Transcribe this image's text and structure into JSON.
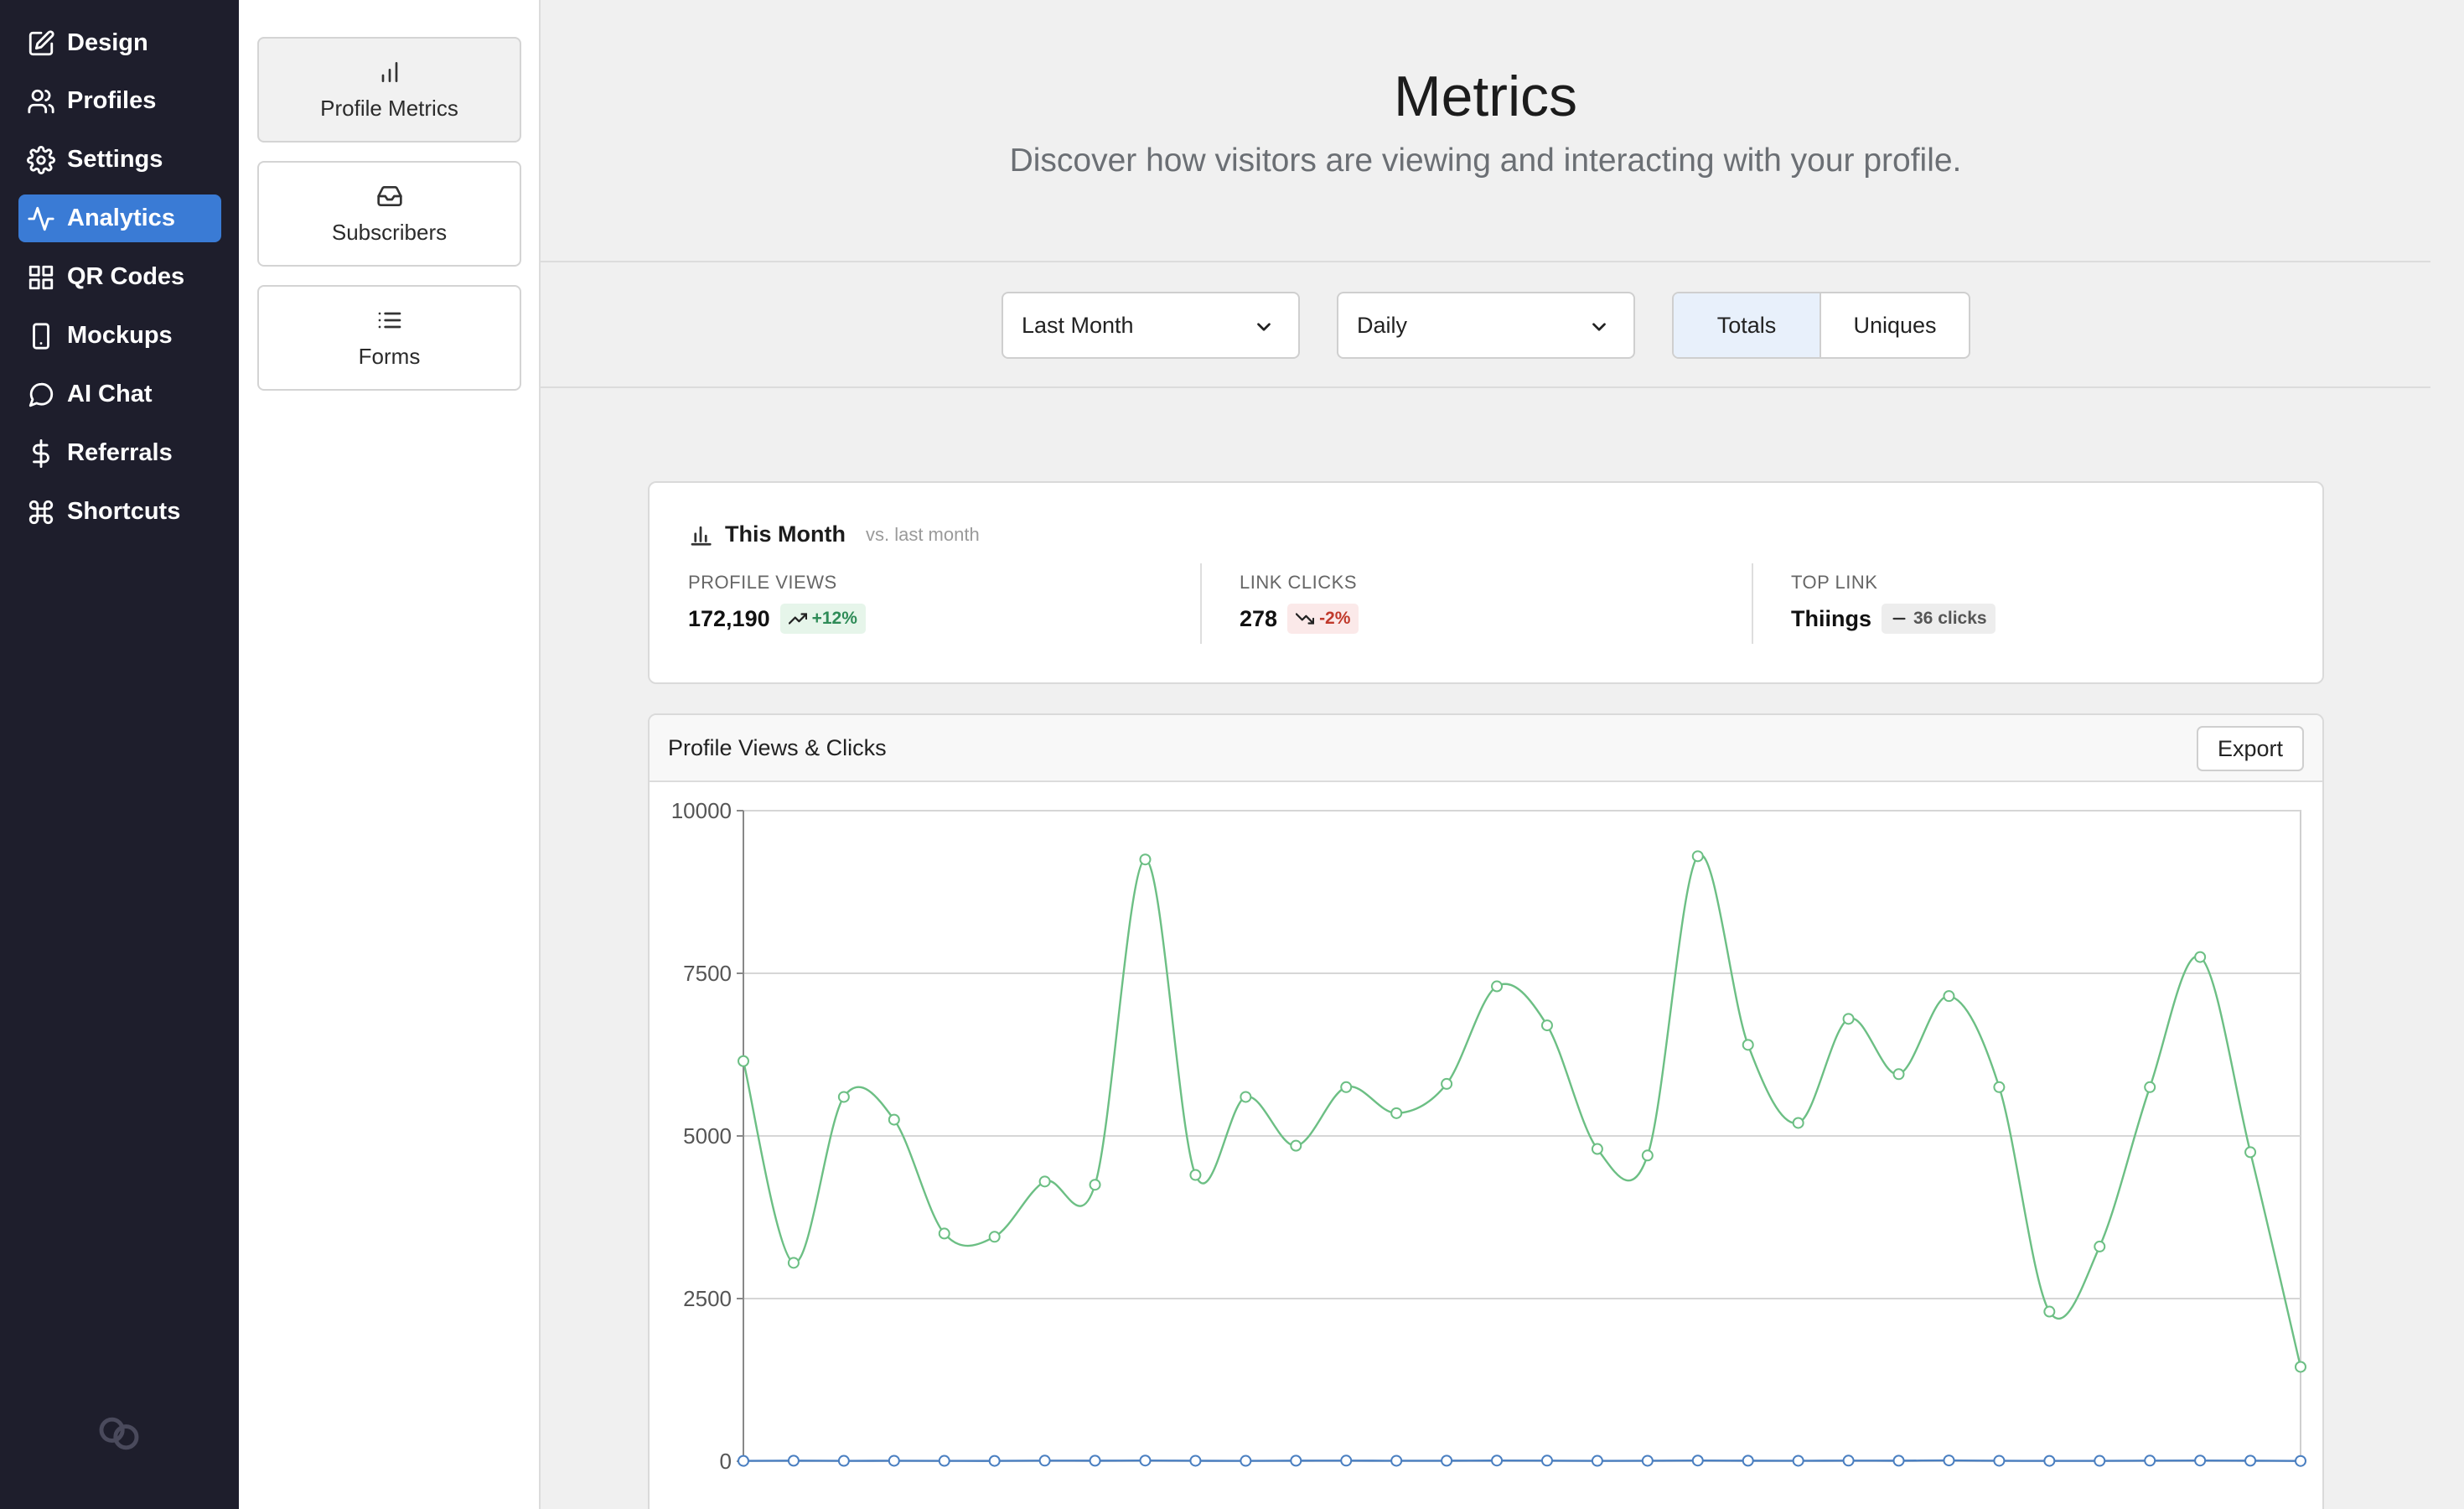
{
  "nav": {
    "items": [
      {
        "label": "Design",
        "icon": "edit-icon"
      },
      {
        "label": "Profiles",
        "icon": "users-icon"
      },
      {
        "label": "Settings",
        "icon": "gear-icon"
      },
      {
        "label": "Analytics",
        "icon": "activity-icon",
        "active": true
      },
      {
        "label": "QR Codes",
        "icon": "grid-icon"
      },
      {
        "label": "Mockups",
        "icon": "phone-icon"
      },
      {
        "label": "AI Chat",
        "icon": "chat-icon"
      },
      {
        "label": "Referrals",
        "icon": "dollar-icon"
      },
      {
        "label": "Shortcuts",
        "icon": "command-icon"
      }
    ],
    "active_color": "#3a7bd5",
    "background": "#1e1e2c"
  },
  "subnav": {
    "items": [
      {
        "label": "Profile Metrics",
        "icon": "bar-chart-icon",
        "active": true
      },
      {
        "label": "Subscribers",
        "icon": "inbox-icon"
      },
      {
        "label": "Forms",
        "icon": "list-icon"
      }
    ]
  },
  "header": {
    "title": "Metrics",
    "subtitle": "Discover how visitors are viewing and interacting with your profile."
  },
  "filters": {
    "range": "Last Month",
    "interval": "Daily",
    "mode_options": [
      "Totals",
      "Uniques"
    ],
    "mode_selected": "Totals"
  },
  "summary": {
    "title": "This Month",
    "comparison": "vs. last month",
    "stats": [
      {
        "label": "PROFILE VIEWS",
        "value": "172,190",
        "change": "+12%",
        "trend": "up"
      },
      {
        "label": "LINK CLICKS",
        "value": "278",
        "change": "-2%",
        "trend": "down"
      },
      {
        "label": "TOP LINK",
        "value": "Thiings",
        "change": "36 clicks",
        "trend": "neutral"
      }
    ],
    "colors": {
      "up": "#2e8b57",
      "down": "#c0392b"
    }
  },
  "chart": {
    "title": "Profile Views & Clicks",
    "export_label": "Export"
  },
  "chart_data": {
    "type": "line",
    "ylim": [
      0,
      10000
    ],
    "yticks": [
      0,
      2500,
      5000,
      7500,
      10000
    ],
    "x": [
      1,
      2,
      3,
      4,
      5,
      6,
      7,
      8,
      9,
      10,
      11,
      12,
      13,
      14,
      15,
      16,
      17,
      18,
      19,
      20,
      21,
      22,
      23,
      24,
      25,
      26,
      27,
      28,
      29,
      30,
      31,
      32
    ],
    "series": [
      {
        "color": "#6cbf84",
        "values": [
          6150,
          3050,
          5600,
          5250,
          3500,
          3450,
          4300,
          4250,
          9250,
          4400,
          5600,
          4850,
          5750,
          5350,
          5800,
          7300,
          6700,
          4800,
          4700,
          9300,
          6400,
          5200,
          6800,
          5950,
          7150,
          5750,
          2300,
          3300,
          5750,
          7750,
          4750,
          1450
        ]
      },
      {
        "color": "#4a7fc1",
        "values": [
          5,
          8,
          6,
          7,
          6,
          5,
          9,
          8,
          10,
          7,
          6,
          8,
          9,
          7,
          8,
          10,
          9,
          6,
          7,
          10,
          8,
          7,
          9,
          8,
          12,
          7,
          5,
          6,
          9,
          10,
          8,
          4
        ]
      }
    ]
  }
}
